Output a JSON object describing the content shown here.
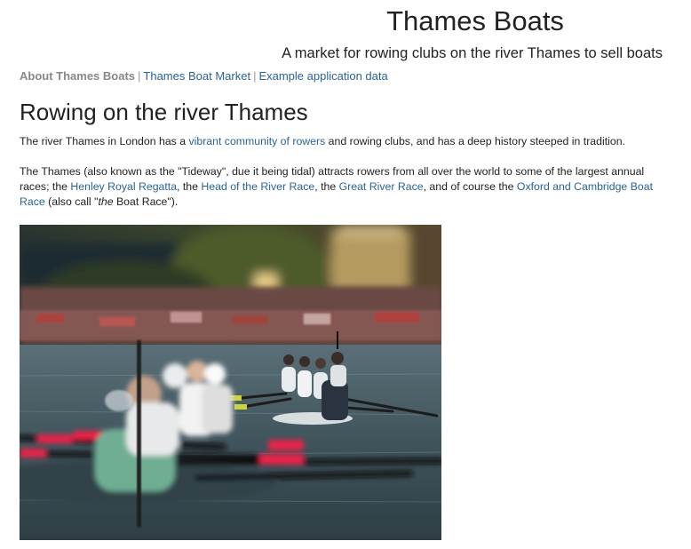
{
  "header": {
    "title": "Thames Boats",
    "subtitle": "A market for rowing clubs on the river Thames to sell boats"
  },
  "nav": {
    "items": [
      {
        "label": "About Thames Boats",
        "current": true
      },
      {
        "label": "Thames Boat Market",
        "current": false
      },
      {
        "label": "Example application data",
        "current": false
      }
    ],
    "separator": "|"
  },
  "main": {
    "heading": "Rowing on the river Thames",
    "p1": {
      "before": "The river Thames in London has a ",
      "link": "vibrant community of rowers",
      "after": " and rowing clubs, and has a deep history steeped in tradition."
    },
    "p2": {
      "t1": "The Thames (also known as the \"Tideway\", due it being tidal) attracts rowers from all over the world to some of the largest annual races; the ",
      "link1": "Henley Royal Regatta",
      "t2": ", the ",
      "link2": "Head of the River Race",
      "t3": ", the ",
      "link3": "Great River Race",
      "t4": ", and of course the ",
      "link4": "Oxford and Cambridge Boat Race",
      "t5": " (also call \"",
      "em": "the",
      "t6": " Boat Race\")."
    },
    "photo": {
      "subject": "rowing-eights-racing-photo"
    }
  },
  "colors": {
    "link": "#2a6496",
    "nav_current": "#888888",
    "text": "#222222"
  }
}
